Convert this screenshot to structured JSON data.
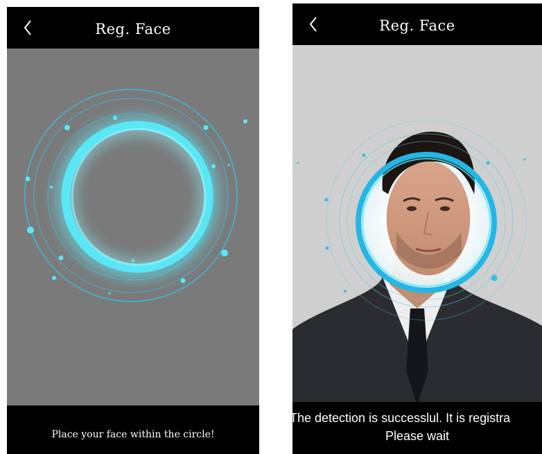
{
  "screens": [
    {
      "title": "Reg. Face",
      "back_icon": "chevron-left-icon",
      "status": "Place your face within the circle!"
    },
    {
      "title": "Reg. Face",
      "back_icon": "chevron-left-icon",
      "status_line1": "The detection is successlul. It is registra",
      "status_line2": "Please wait"
    }
  ],
  "colors": {
    "bar_background": "#000000",
    "camera_background_scanning": "#7a7a7a",
    "camera_background_detected": "#cfcfcf",
    "ring_accent": "#5be6f5",
    "ring_line": "#3fb8d6"
  }
}
